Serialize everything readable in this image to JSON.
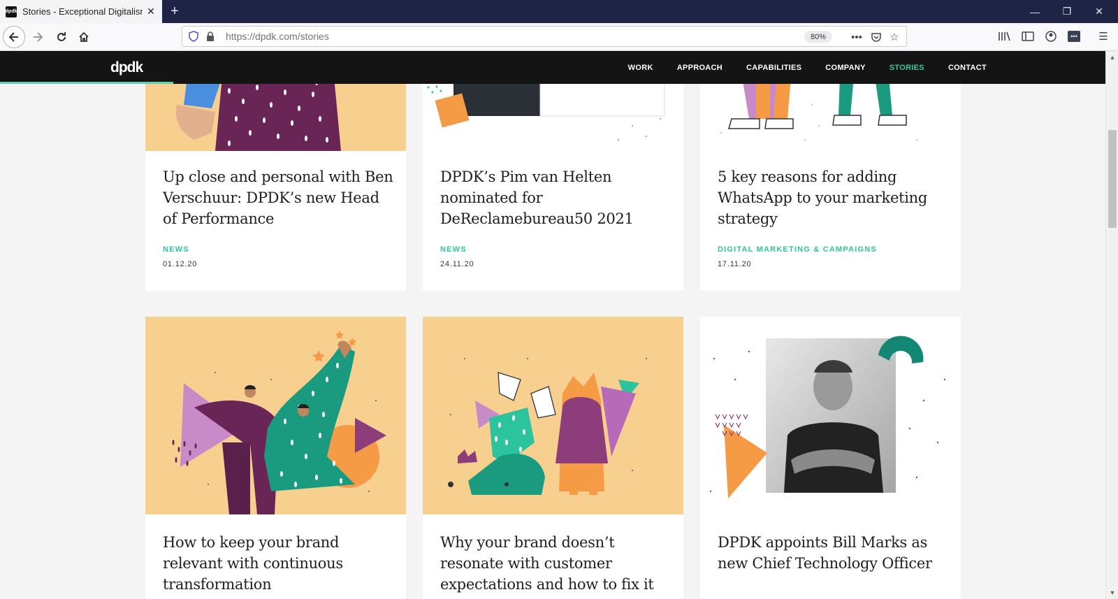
{
  "browser": {
    "tab_title": "Stories - Exceptional Digitalism",
    "favicon_text": "dpdk",
    "url": "https://dpdk.com/stories",
    "zoom": "80%"
  },
  "site": {
    "logo": "dpdk",
    "nav": [
      {
        "label": "WORK"
      },
      {
        "label": "APPROACH"
      },
      {
        "label": "CAPABILITIES"
      },
      {
        "label": "COMPANY"
      },
      {
        "label": "STORIES"
      },
      {
        "label": "CONTACT"
      }
    ]
  },
  "cards": [
    {
      "title": "Up close and personal with Ben Verschuur: DPDK’s new Head of Performance",
      "category": "NEWS",
      "date": "01.12.20"
    },
    {
      "title": "DPDK’s Pim van Helten nominated for DeReclamebureau50 2021",
      "category": "NEWS",
      "date": "24.11.20"
    },
    {
      "title": "5 key reasons for adding WhatsApp to your marketing strategy",
      "category": "DIGITAL MARKETING & CAMPAIGNS",
      "date": "17.11.20"
    },
    {
      "title": "How to keep your brand relevant with continuous transformation"
    },
    {
      "title": "Why your brand doesn’t resonate with customer expectations and how to fix it"
    },
    {
      "title": "DPDK appoints Bill Marks as new Chief Technology Officer"
    }
  ],
  "colors": {
    "accent": "#39c7a0",
    "header_bg": "#141414",
    "illustration_bg": "#f7cf8f"
  }
}
